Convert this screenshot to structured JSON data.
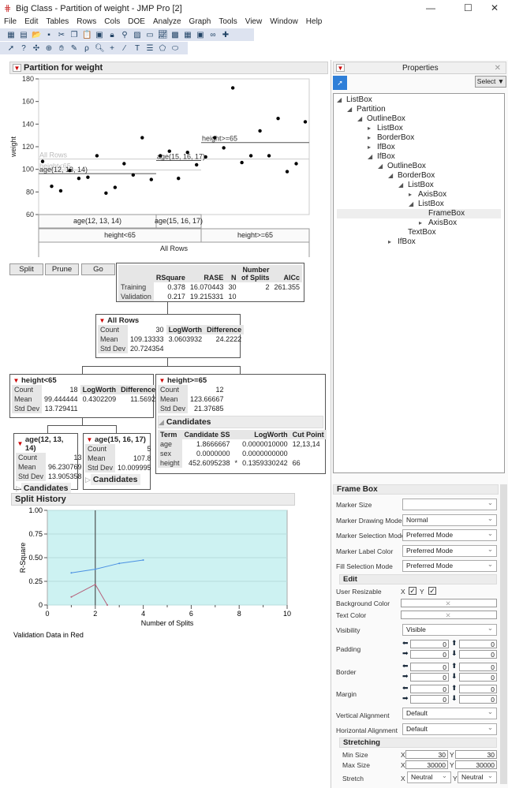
{
  "window": {
    "title": "Big Class - Partition of weight - JMP Pro [2]",
    "min": "—",
    "max": "☐",
    "close": "✕"
  },
  "menu": [
    "File",
    "Edit",
    "Tables",
    "Rows",
    "Cols",
    "DOE",
    "Analyze",
    "Graph",
    "Tools",
    "View",
    "Window",
    "Help"
  ],
  "report": {
    "title": "Partition for weight",
    "plot": {
      "ylabel": "weight",
      "yticks": [
        "60",
        "80",
        "100",
        "120",
        "140",
        "160",
        "180"
      ],
      "ymin": 60,
      "ymax": 180,
      "weights": [
        107,
        85,
        81,
        99,
        92,
        93,
        112,
        79,
        84,
        105,
        95,
        128,
        91,
        112,
        116,
        92,
        115,
        104,
        111,
        128,
        119,
        172,
        106,
        112,
        134,
        112,
        145,
        98,
        105,
        142
      ],
      "labels": {
        "all": "All Rows",
        "hlt": "height<65",
        "a1": "age(12, 13, 14)",
        "a2": "age(15, 16, 17)",
        "hge": "height>=65"
      },
      "means": {
        "all": 109.13333,
        "hlt": 99.444444,
        "a1": 96.230769,
        "a2": 107.8,
        "hge": 123.66667
      },
      "axis": {
        "a1": "age(12, 13, 14)",
        "a2": "age(15, 16, 17)",
        "hlt": "height<65",
        "hge": "height>=65",
        "all": "All Rows"
      }
    },
    "buttons": {
      "split": "Split",
      "prune": "Prune",
      "go": "Go"
    },
    "summary": {
      "headers": [
        "",
        "RSquare",
        "RASE",
        "N",
        "Number of Splits",
        "AICc"
      ],
      "rows": [
        [
          "Training",
          "0.378",
          "16.070443",
          "30",
          "2",
          "261.355"
        ],
        [
          "Validation",
          "0.217",
          "19.215331",
          "10",
          "",
          ""
        ]
      ]
    },
    "nodes": {
      "all": {
        "title": "All Rows",
        "count": "30",
        "mean": "109.13333",
        "sd": "20.724354",
        "lw": "3.0603932",
        "diff": "24.2222"
      },
      "hlt": {
        "title": "height<65",
        "count": "18",
        "mean": "99.444444",
        "sd": "13.729411",
        "lw": "0.4302209",
        "diff": "11.5692"
      },
      "hge": {
        "title": "height>=65",
        "count": "12",
        "mean": "123.66667",
        "sd": "21.37685"
      },
      "a1": {
        "title": "age(12, 13, 14)",
        "count": "13",
        "mean": "96.230769",
        "sd": "13.905358"
      },
      "a2": {
        "title": "age(15, 16, 17)",
        "count": "5",
        "mean": "107.8",
        "sd": "10.009995"
      }
    },
    "lbl": {
      "count": "Count",
      "mean": "Mean",
      "sd": "Std Dev",
      "lw": "LogWorth",
      "diff": "Difference",
      "cand": "Candidates"
    },
    "candidates": {
      "headers": [
        "Term",
        "Candidate SS",
        "",
        "LogWorth",
        "Cut Point"
      ],
      "rows": [
        [
          "age",
          "1.8666667",
          "",
          "0.0000010000",
          "12,13,14"
        ],
        [
          "sex",
          "0.0000000",
          "",
          "0.0000000000",
          ""
        ],
        [
          "height",
          "452.6095238",
          "*",
          "0.1359330242",
          "66"
        ]
      ]
    },
    "history": {
      "title": "Split History",
      "ylabel": "R-Square",
      "xlabel": "Number of Splits",
      "note": "Validation Data in Red",
      "yticks": [
        "0",
        "0.25",
        "0.50",
        "0.75",
        "1.00"
      ],
      "xticks": [
        "0",
        "2",
        "4",
        "6",
        "8",
        "10"
      ],
      "current": 2,
      "training": [
        [
          1,
          0.34
        ],
        [
          2,
          0.378
        ],
        [
          3,
          0.44
        ],
        [
          4,
          0.475
        ]
      ],
      "validation": [
        [
          1,
          0.085
        ],
        [
          2,
          0.217
        ],
        [
          2.5,
          0
        ]
      ],
      "colors": {
        "training": "#4a90e2",
        "validation": "#b5607a",
        "bg": "#cdf2f2"
      }
    }
  },
  "props": {
    "title": "Properties",
    "select": "Select ▼",
    "tree": [
      [
        0,
        "◢",
        "ListBox"
      ],
      [
        1,
        "◢",
        "Partition"
      ],
      [
        2,
        "◢",
        "OutlineBox"
      ],
      [
        3,
        "▸",
        "ListBox"
      ],
      [
        3,
        "▸",
        "BorderBox"
      ],
      [
        3,
        "▸",
        "IfBox"
      ],
      [
        3,
        "◢",
        "IfBox"
      ],
      [
        4,
        "◢",
        "OutlineBox"
      ],
      [
        5,
        "◢",
        "BorderBox"
      ],
      [
        6,
        "◢",
        "ListBox"
      ],
      [
        7,
        "▸",
        "AxisBox"
      ],
      [
        7,
        "◢",
        "ListBox"
      ],
      [
        8,
        "",
        "FrameBox"
      ],
      [
        8,
        "▸",
        "AxisBox"
      ],
      [
        6,
        "",
        "TextBox"
      ],
      [
        5,
        "▸",
        "IfBox"
      ]
    ],
    "frame": "Frame Box",
    "rows": [
      [
        "Marker Size",
        ""
      ],
      [
        "Marker Drawing Mode",
        "Normal"
      ],
      [
        "Marker Selection Mode",
        "Preferred Mode"
      ],
      [
        "Marker Label Color",
        "Preferred Mode"
      ],
      [
        "Fill Selection Mode",
        "Preferred Mode"
      ]
    ],
    "edit": "Edit",
    "resizable": "User Resizable",
    "x": "X",
    "y": "Y",
    "bg": "Background Color",
    "tc": "Text Color",
    "visibility": "Visibility",
    "visval": "Visible",
    "padding": "Padding",
    "border": "Border",
    "margin": "Margin",
    "zero": "0",
    "valign": "Vertical Alignment",
    "halign": "Horizontal Alignment",
    "default": "Default",
    "stretching": "Stretching",
    "minsize": "Min Size",
    "maxsize": "Max Size",
    "stretch": "Stretch",
    "min": "30",
    "max": "30000",
    "neutral": "Neutral"
  }
}
